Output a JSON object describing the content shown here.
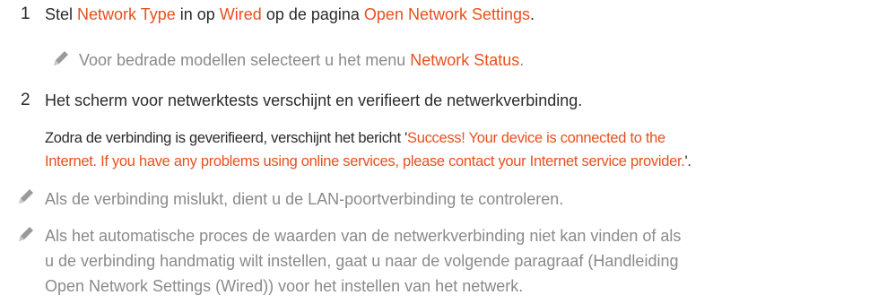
{
  "step1": {
    "number": "1",
    "text_a": "Stel ",
    "hl_network_type": "Network Type",
    "text_b": " in op ",
    "hl_wired": "Wired",
    "text_c": " op de pagina ",
    "hl_open_network_settings": "Open Network Settings",
    "text_d": ".",
    "note_text_a": "Voor bedrade modellen selecteert u het menu ",
    "note_hl_network_status": "Network Status",
    "note_text_b": "."
  },
  "step2": {
    "number": "2",
    "text": "Het scherm voor netwerktests verschijnt en verifieert de netwerkverbinding.",
    "message_text_a": "Zodra de verbinding is geverifieerd, verschijnt het bericht '",
    "message_hl_line1": "Success! Your device is connected to the",
    "message_hl_line2": "Internet. If you have any problems using online services, please contact your Internet service provider.",
    "message_text_b": "'."
  },
  "notes": [
    {
      "icon": "pencil-icon",
      "text": "Als de verbinding mislukt, dient u de LAN-poortverbinding te controleren."
    },
    {
      "icon": "pencil-icon",
      "lines": [
        "Als het automatische proces de waarden van de netwerkverbinding niet kan vinden of als",
        "u de verbinding handmatig wilt instellen, gaat u naar de volgende paragraaf (Handleiding",
        "Open Network Settings (Wired)) voor het instellen van het netwerk."
      ]
    }
  ],
  "colors": {
    "highlight": "#e8501e",
    "body_text": "#2b2b2b",
    "note_text": "#8a8a8a"
  }
}
